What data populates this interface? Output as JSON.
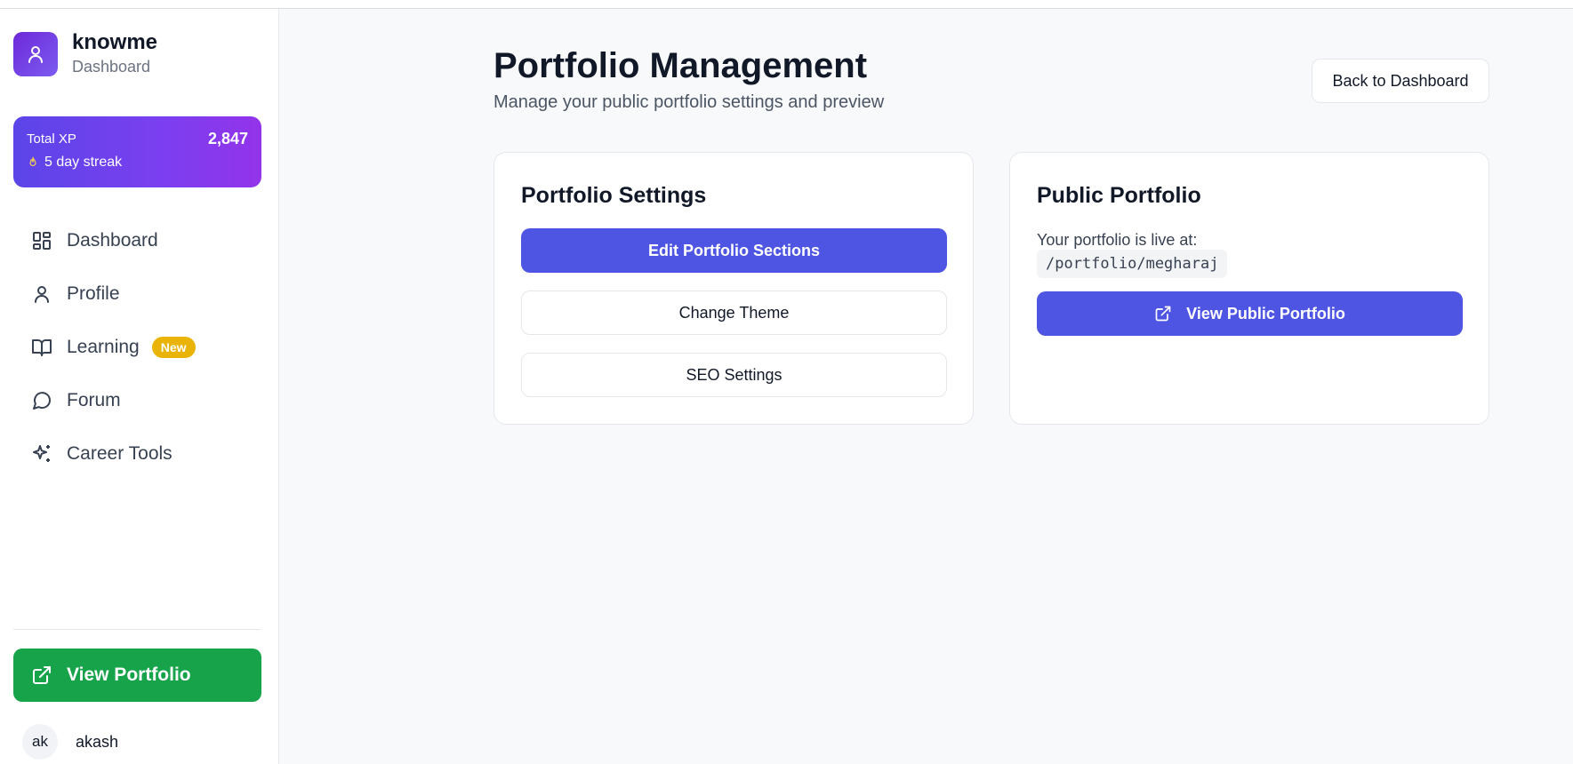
{
  "brand": {
    "name": "knowme",
    "subtitle": "Dashboard"
  },
  "xp": {
    "label": "Total XP",
    "value": "2,847",
    "streak": "5 day streak"
  },
  "nav": [
    {
      "label": "Dashboard",
      "icon": "layout-grid-icon"
    },
    {
      "label": "Profile",
      "icon": "user-icon"
    },
    {
      "label": "Learning",
      "icon": "book-open-icon",
      "badge": "New"
    },
    {
      "label": "Forum",
      "icon": "message-circle-icon"
    },
    {
      "label": "Career Tools",
      "icon": "sparkles-icon"
    }
  ],
  "sidebar_footer": {
    "view_portfolio": "View Portfolio"
  },
  "user": {
    "initials": "ak",
    "name": "akash"
  },
  "page": {
    "title": "Portfolio Management",
    "subtitle": "Manage your public portfolio settings and preview",
    "back_button": "Back to Dashboard"
  },
  "settings_card": {
    "title": "Portfolio Settings",
    "edit_sections": "Edit Portfolio Sections",
    "change_theme": "Change Theme",
    "seo_settings": "SEO Settings"
  },
  "public_card": {
    "title": "Public Portfolio",
    "live_label": "Your portfolio is live at:",
    "path": "/portfolio/megharaj",
    "view_button": "View Public Portfolio"
  },
  "colors": {
    "primary": "#4f55e3",
    "success": "#16a34a",
    "badge": "#eab308",
    "xp_gradient_start": "#5b45e8",
    "xp_gradient_end": "#9333ea"
  }
}
